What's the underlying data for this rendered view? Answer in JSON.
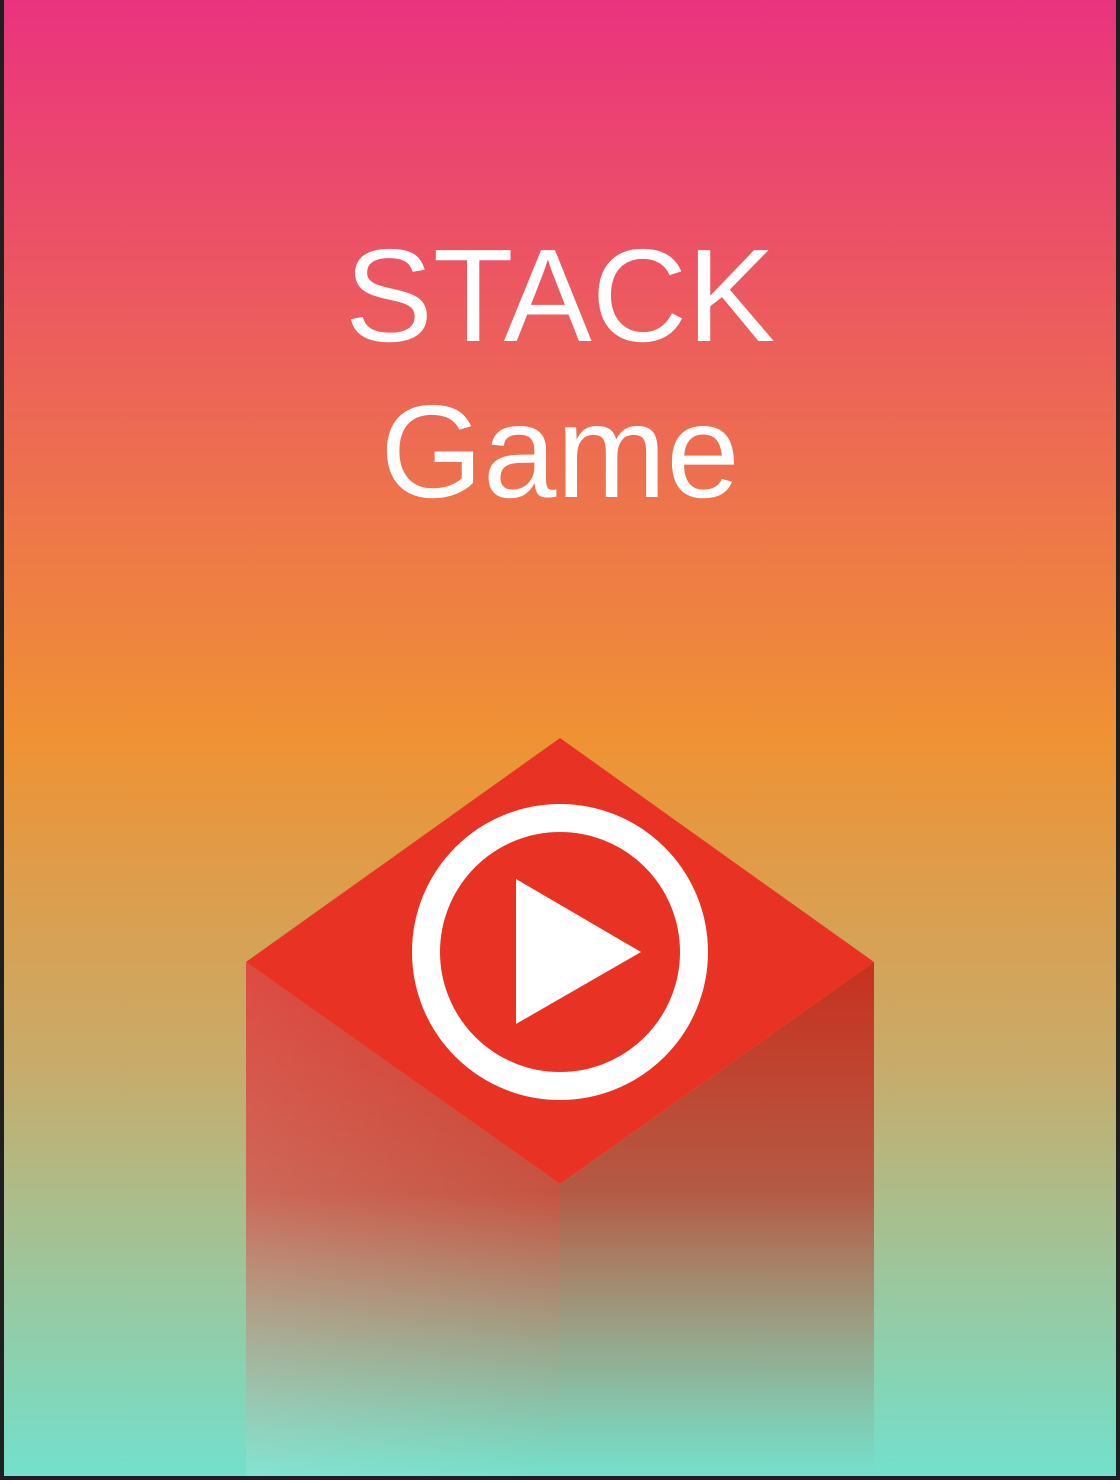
{
  "game": {
    "title_line1": "STACK",
    "title_line2": "Game"
  },
  "colors": {
    "bg_top": "#ea337e",
    "bg_mid": "#ef9234",
    "bg_bottom": "#73e0cc",
    "block_top": "#e83324",
    "block_side": "#d9352a",
    "icon_white": "#ffffff"
  },
  "icons": {
    "play": "play-circle-icon"
  }
}
